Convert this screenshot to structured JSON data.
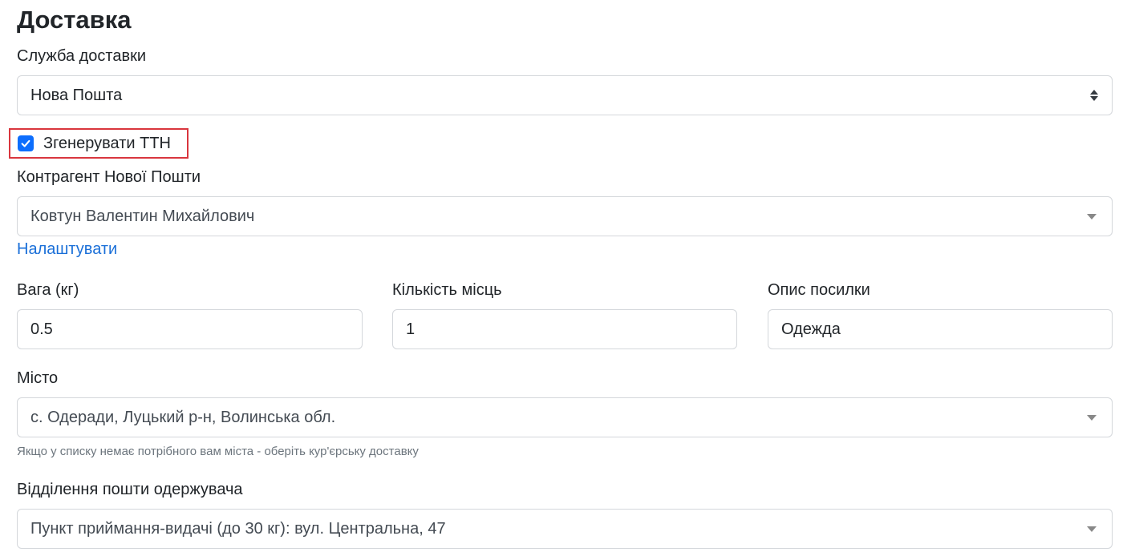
{
  "section": {
    "title": "Доставка"
  },
  "delivery_service": {
    "label": "Служба доставки",
    "value": "Нова Пошта"
  },
  "generate_ttn": {
    "label": "Згенерувати ТТН",
    "checked": true
  },
  "counterparty": {
    "label": "Контрагент Нової Пошти",
    "value": "Ковтун Валентин Михайлович",
    "settings_link": "Налаштувати"
  },
  "weight": {
    "label": "Вага (кг)",
    "value": "0.5"
  },
  "places": {
    "label": "Кількість місць",
    "value": "1"
  },
  "description": {
    "label": "Опис посилки",
    "value": "Одежда"
  },
  "city": {
    "label": "Місто",
    "value": "с. Одеради, Луцький р-н, Волинська обл.",
    "hint": "Якщо у списку немає потрібного вам міста - оберіть кур'єрську доставку"
  },
  "branch": {
    "label": "Відділення пошти одержувача",
    "value": "Пункт приймання-видачі (до 30 кг): вул. Центральна, 47"
  },
  "colors": {
    "accent": "#0d6efd",
    "link": "#1a6fd8",
    "highlight_border": "#d9363e"
  }
}
